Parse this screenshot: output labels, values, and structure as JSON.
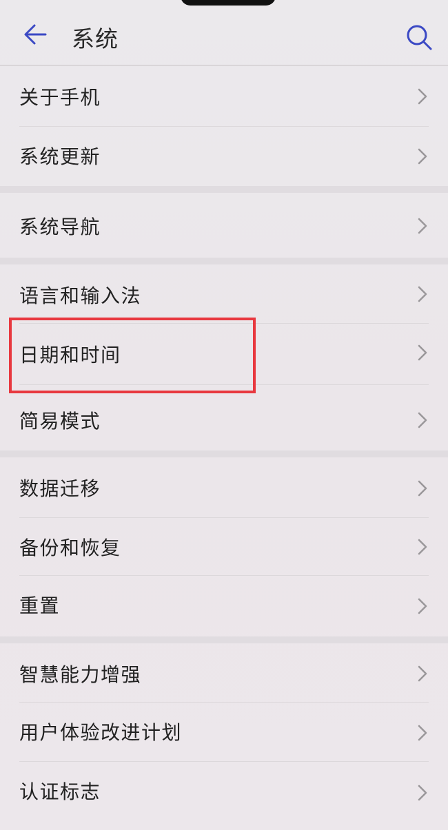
{
  "header": {
    "title": "系统"
  },
  "settings": {
    "items": [
      {
        "label": "关于手机"
      },
      {
        "label": "系统更新"
      },
      {
        "label": "系统导航"
      },
      {
        "label": "语言和输入法"
      },
      {
        "label": "日期和时间"
      },
      {
        "label": "简易模式"
      },
      {
        "label": "数据迁移"
      },
      {
        "label": "备份和恢复"
      },
      {
        "label": "重置"
      },
      {
        "label": "智慧能力增强"
      },
      {
        "label": "用户体验改进计划"
      },
      {
        "label": "认证标志"
      }
    ]
  },
  "colors": {
    "accent": "#3b49c4",
    "highlight": "#e8383f"
  },
  "icons": {
    "back": "arrow-left-icon",
    "search": "search-icon",
    "chevron": "chevron-right-icon"
  }
}
